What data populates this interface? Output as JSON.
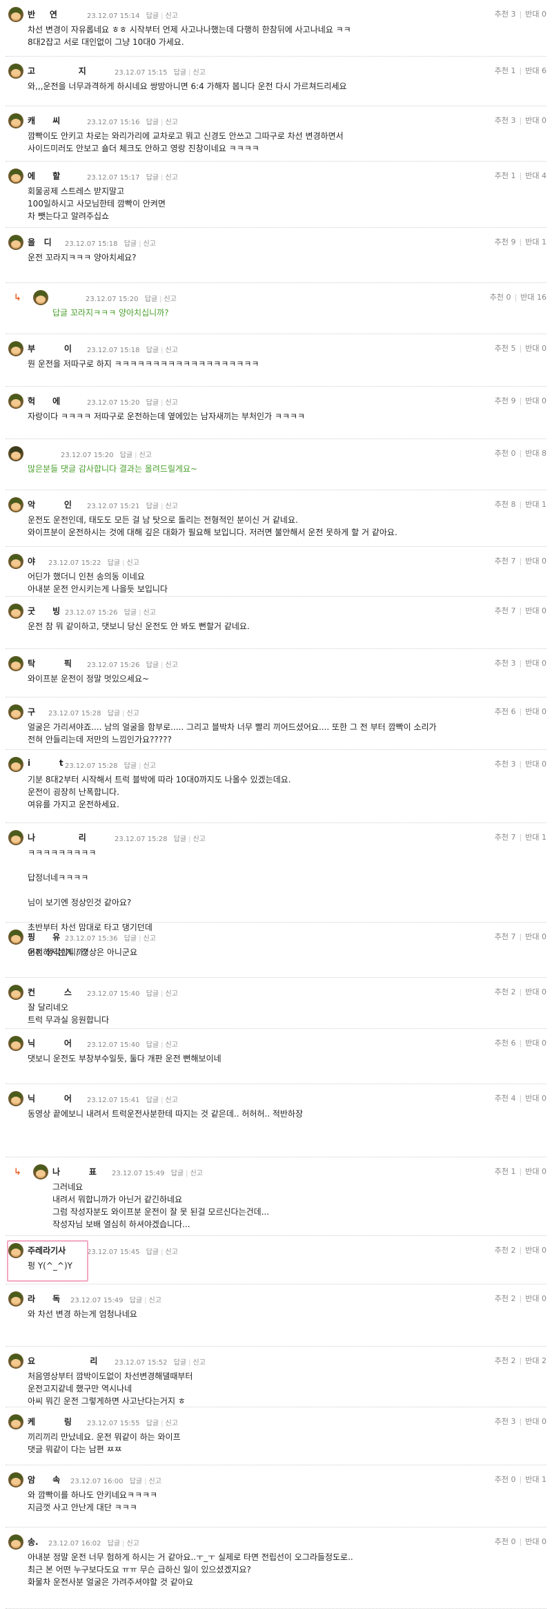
{
  "labels": {
    "reply": "답글",
    "report": "신고",
    "recommend": "추천",
    "oppose": "반대"
  },
  "comments": [
    {
      "nick": "반     연",
      "date": "23.12.07 15:14",
      "up": 3,
      "down": 0,
      "lines": [
        "차선 변경이 자유롭네요 ㅎㅎ 시작부터 언제 사고나나했는데 다행히 한참뒤에 사고나네요 ㅋㅋ",
        "8대2잡고 서로 대인없이 그냥 10대0 가세요."
      ]
    },
    {
      "nick": "고               지",
      "date": "23.12.07 15:15",
      "up": 1,
      "down": 6,
      "lines": [
        "와,,,운전을 너무과격하게 하시네요 쌍방아니면 6:4 가해자 봅니다 운전 다시 가르쳐드리세요"
      ]
    },
    {
      "nick": "캐      씨",
      "date": "23.12.07 15:16",
      "up": 3,
      "down": 0,
      "lines": [
        "깜빡이도 안키고 차로는 와리가리에 교차로고 뭐고 신경도 안쓰고 그따구로 차선 변경하면서",
        "사이드미러도 안보고 숄더 체크도 안하고 영랑 진창이네요 ㅋㅋㅋㅋ"
      ]
    },
    {
      "nick": "에      할",
      "date": "23.12.07 15:17",
      "up": 1,
      "down": 4,
      "lines": [
        "회물공제 스트레스 받지말고",
        "100일하시고 사모님한테 깜빡이 안켜면",
        "차 뺏는다고 알려주십쇼"
      ]
    },
    {
      "nick": "을   디",
      "date": "23.12.07 15:18",
      "up": 9,
      "down": 1,
      "lines": [
        "운전 꼬라지ㅋㅋㅋ 양아치세요?"
      ]
    },
    {
      "nick": "",
      "date": "23.12.07 15:20",
      "up": 0,
      "down": 16,
      "reply": true,
      "green": true,
      "lines": [
        "답글 꼬라지ㅋㅋㅋ 양아치십니까?"
      ]
    },
    {
      "nick": "부          이",
      "date": "23.12.07 15:18",
      "up": 5,
      "down": 0,
      "lines": [
        "뭔 운전을 저따구로 하지 ㅋㅋㅋㅋㅋㅋㅋㅋㅋㅋㅋㅋㅋㅋㅋㅋㅋㅋㅋ"
      ]
    },
    {
      "nick": "헉      에",
      "date": "23.12.07 15:20",
      "up": 9,
      "down": 0,
      "lines": [
        "자랑이다 ㅋㅋㅋㅋ 저따구로 운전하는데 옆에있는 남자새끼는 부처인가 ㅋㅋㅋㅋ"
      ]
    },
    {
      "nick": "",
      "date": "23.12.07 15:20",
      "up": 0,
      "down": 8,
      "green": true,
      "plain": true,
      "lines": [
        "많은분들 댓글 감사합니다 결과는 올려드릴게요~"
      ]
    },
    {
      "nick": "악          인",
      "date": "23.12.07 15:21",
      "up": 8,
      "down": 1,
      "lines": [
        "운전도 운전인데, 태도도 모든 걸 남 탓으로 돌리는 전형적인 분이신 거 같네요.",
        "와이프분이 운전하시는 것에 대해 깊은 대화가 필요해 보입니다. 저러면 불안해서 운전 못하게 할 거 같아요."
      ]
    },
    {
      "nick": "야",
      "date": "23.12.07 15:22",
      "up": 7,
      "down": 0,
      "lines": [
        "어딘가 했더니 인천 송의동 이네요",
        "아내분 운전 안시키는게 나을듯 보입니다"
      ]
    },
    {
      "nick": "굿      빙",
      "date": "23.12.07 15:26",
      "up": 7,
      "down": 0,
      "lines": [
        "운전 참 뭐 같이하고, 댓보니 당신 운전도 안 봐도 뻔할거 같네요."
      ]
    },
    {
      "nick": "탁          픽",
      "date": "23.12.07 15:26",
      "up": 3,
      "down": 0,
      "lines": [
        "와이프분 운전이 정말 멋있으세요~"
      ]
    },
    {
      "nick": "구",
      "date": "23.12.07 15:28",
      "up": 6,
      "down": 0,
      "lines": [
        "얼굴은 가리셔야죠.... 남의 얼굴을 함부로..... 그리고 블박차 너무 빨리 끼어드셨어요.... 또한 그 전 부터 깜빡이 소리가",
        "전혀 안들리는데 저만의 느낌인가요?????"
      ]
    },
    {
      "nick": "i          t",
      "date": "23.12.07 15:28",
      "up": 3,
      "down": 0,
      "lines": [
        "기분 8대2부터 시작해서 트럭 블박에 따라 10대0까지도 나올수 있겠는데요.",
        "운전이 굉장히 난폭합니다.",
        "여유를 가지고 운전하세요."
      ]
    },
    {
      "nick": "나               리",
      "date": "23.12.07 15:28",
      "up": 7,
      "down": 1,
      "lines": [
        "ㅋㅋㅋㅋㅋㅋㅋㅋㅋ",
        "",
        "답정너네ㅋㅋㅋㅋ",
        "",
        "님이 보기엔 정상인것 같아요?",
        "",
        "초반부터 차선 맘대로 타고 댕기던데",
        "",
        "어찌 생각합니까?"
      ]
    },
    {
      "nick": "핑      유",
      "date": "23.12.07 15:36",
      "up": 7,
      "down": 0,
      "lines": [
        "운전하시는게 ; 정상은 아니군요"
      ]
    },
    {
      "nick": "컨          스",
      "date": "23.12.07 15:40",
      "up": 2,
      "down": 0,
      "lines": [
        "잘 달리네오",
        "트럭 무과실 응원합니다"
      ]
    },
    {
      "nick": "닉          어",
      "date": "23.12.07 15:40",
      "up": 6,
      "down": 0,
      "lines": [
        "댓보니 운전도 부창부수일듯, 둘다 개판 운전 뻔해보이네"
      ]
    },
    {
      "nick": "닉          어",
      "date": "23.12.07 15:41",
      "up": 4,
      "down": 0,
      "lines": [
        "동영상 끝에보니 내려서 트럭운전사분한테 따지는 것 같은데.. 허허허.. 적반하장"
      ]
    },
    {
      "nick": "나          표",
      "date": "23.12.07 15:49",
      "up": 1,
      "down": 0,
      "reply": true,
      "lines": [
        "그러네요",
        "내려서 뭐합니까가 아닌거 같긴하네요",
        "그럼 작성자분도 와이프분 운전이 잘 못 된걸 모르신다는건데...",
        "작성자님 보배 열심히 하셔야겠습니다..."
      ]
    },
    {
      "nick": "주레라기사",
      "date": "23.12.07 15:45",
      "up": 2,
      "down": 0,
      "highlight": true,
      "lines": [
        "펑 Y(^_^)Y"
      ]
    },
    {
      "nick": "라      독",
      "date": "23.12.07 15:49",
      "up": 2,
      "down": 0,
      "lines": [
        "와 차선 변경 하는게 엄청나네요"
      ]
    },
    {
      "nick": "요                   리",
      "date": "23.12.07 15:52",
      "up": 2,
      "down": 2,
      "lines": [
        "처음영상부터 깜박이도없이 차선변경해댈때부터",
        "운전고지같네 했구만 역시나네",
        "아씨 뭐긴 운전 그렇게하면 사고난다는거지 ㅎ"
      ]
    },
    {
      "nick": "케          링",
      "date": "23.12.07 15:55",
      "up": 3,
      "down": 0,
      "lines": [
        "끼리끼리 만났네요. 운전 뭐같이 하는 와이프",
        "댓글 뭐같이 다는 남편 ㅉㅉ"
      ]
    },
    {
      "nick": "암      속",
      "date": "23.12.07 16:00",
      "up": 0,
      "down": 1,
      "lines": [
        "와 깜빡이를 하나도 안키네요ㅋㅋㅋㅋ",
        "지금껏 사고 안난게 대단 ㅋㅋㅋ"
      ]
    },
    {
      "nick": "송.",
      "date": "23.12.07 16:02",
      "up": 0,
      "down": 0,
      "lines": [
        "아내분 정말 운전 너무 험하게 하시는 거 같아요..ㅜ_ㅜ 실제로 타면 전립선이 오그라들정도로..",
        "최근 본 어떤 누구보다도요 ㅠㅠ 무슨 급하신 일이 있으셨겠지요?",
        "화물차 운전사분 얼굴은 가려주셔야할 것 같아요"
      ]
    }
  ]
}
